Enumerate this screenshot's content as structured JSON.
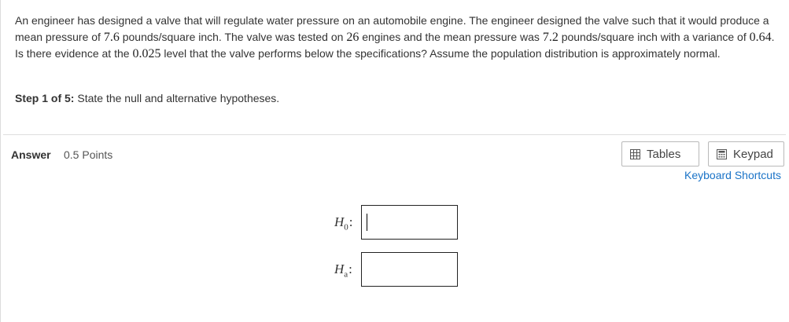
{
  "question": {
    "p1": "An engineer has designed a valve that will regulate water pressure on an automobile engine. The engineer designed the valve such that it would produce a mean pressure of ",
    "v1": "7.6",
    "p2": " pounds/square inch. The valve was tested on ",
    "v2": "26",
    "p3": " engines and the mean pressure was ",
    "v3": "7.2",
    "p4": " pounds/square inch with a variance of ",
    "v4": "0.64",
    "p5": ". Is there evidence at the ",
    "v5": "0.025",
    "p6": " level that the valve performs below the specifications? Assume the population distribution is approximately normal."
  },
  "step": {
    "label": "Step 1 of 5:",
    "text": " State the null and alternative hypotheses."
  },
  "answer": {
    "label": "Answer",
    "points": "0.5 Points"
  },
  "toolbar": {
    "tables_label": "Tables",
    "keypad_label": "Keypad",
    "shortcuts_label": "Keyboard Shortcuts"
  },
  "hypotheses": {
    "h0": {
      "symbol": "H",
      "sub": "0",
      "value": ""
    },
    "ha": {
      "symbol": "H",
      "sub": "a",
      "value": ""
    }
  },
  "icons": {
    "tables": "table-icon",
    "keypad": "calculator-icon"
  }
}
